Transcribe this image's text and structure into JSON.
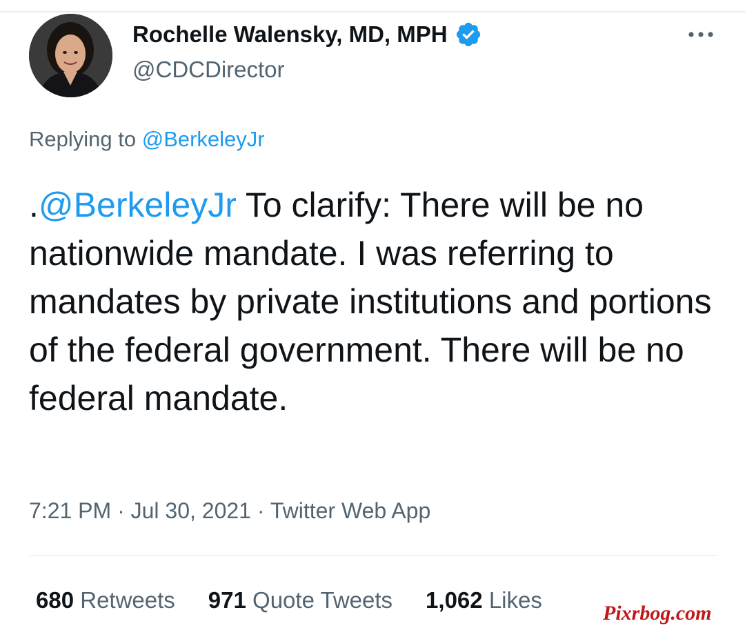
{
  "author": {
    "display_name": "Rochelle Walensky, MD, MPH",
    "handle": "@CDCDirector",
    "verified": true
  },
  "icons": {
    "avatar": "profile-photo",
    "verified": "verified-badge-icon",
    "more": "more-options-icon"
  },
  "reply": {
    "prefix": "Replying to",
    "handle": "@BerkeleyJr"
  },
  "tweet": {
    "lead": ".",
    "mention": "@BerkeleyJr",
    "body": " To clarify: There will be no nationwide mandate. I was referring to mandates by private institutions and portions of the federal government. There will be no federal mandate."
  },
  "meta": {
    "time": "7:21 PM",
    "separator": " · ",
    "date": "Jul 30, 2021",
    "source": "Twitter Web App"
  },
  "stats": {
    "retweets_count": "680",
    "retweets_label": "Retweets",
    "quotes_count": "971",
    "quotes_label": "Quote Tweets",
    "likes_count": "1,062",
    "likes_label": "Likes"
  },
  "watermark": "Pixrbog.com",
  "colors": {
    "link": "#1d9bf0",
    "secondary_text": "#536471",
    "primary_text": "#0f1419",
    "verified": "#1d9bf0",
    "watermark": "#c01818"
  }
}
